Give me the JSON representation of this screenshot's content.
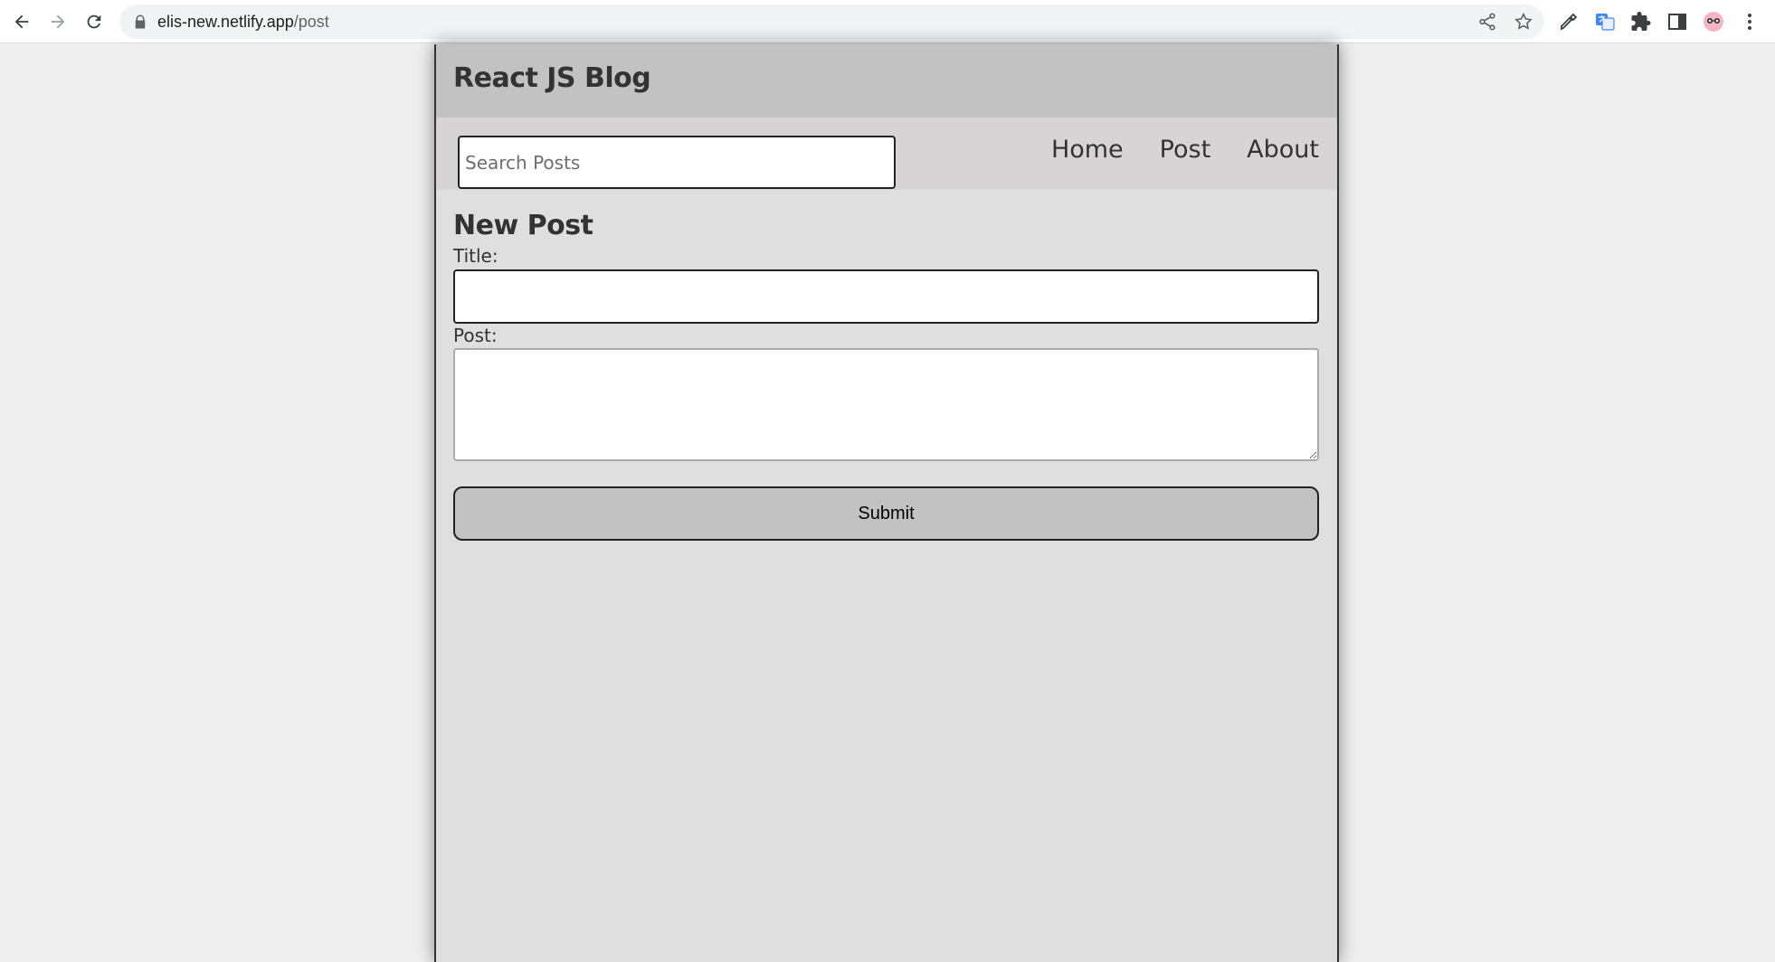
{
  "browser": {
    "url_host": "elis-new.netlify.app",
    "url_path": "/post",
    "icons": [
      "back-arrow-icon",
      "forward-arrow-icon",
      "reload-icon",
      "lock-icon",
      "share-icon",
      "star-icon",
      "eyedropper-icon",
      "translate-icon",
      "puzzle-icon",
      "sidepanel-icon",
      "profile-avatar-icon",
      "kebab-menu-icon"
    ]
  },
  "header": {
    "title": "React JS Blog"
  },
  "nav": {
    "search_placeholder": "Search Posts",
    "search_value": "",
    "links": [
      "Home",
      "Post",
      "About"
    ]
  },
  "new_post": {
    "heading": "New Post",
    "title_label": "Title:",
    "title_value": "",
    "post_label": "Post:",
    "post_value": "",
    "submit_label": "Submit"
  },
  "colors": {
    "header_bg": "#c2c2c2",
    "nav_bg": "#d6d4d4",
    "main_bg": "#dfdfdf",
    "page_bg": "#efefef"
  }
}
